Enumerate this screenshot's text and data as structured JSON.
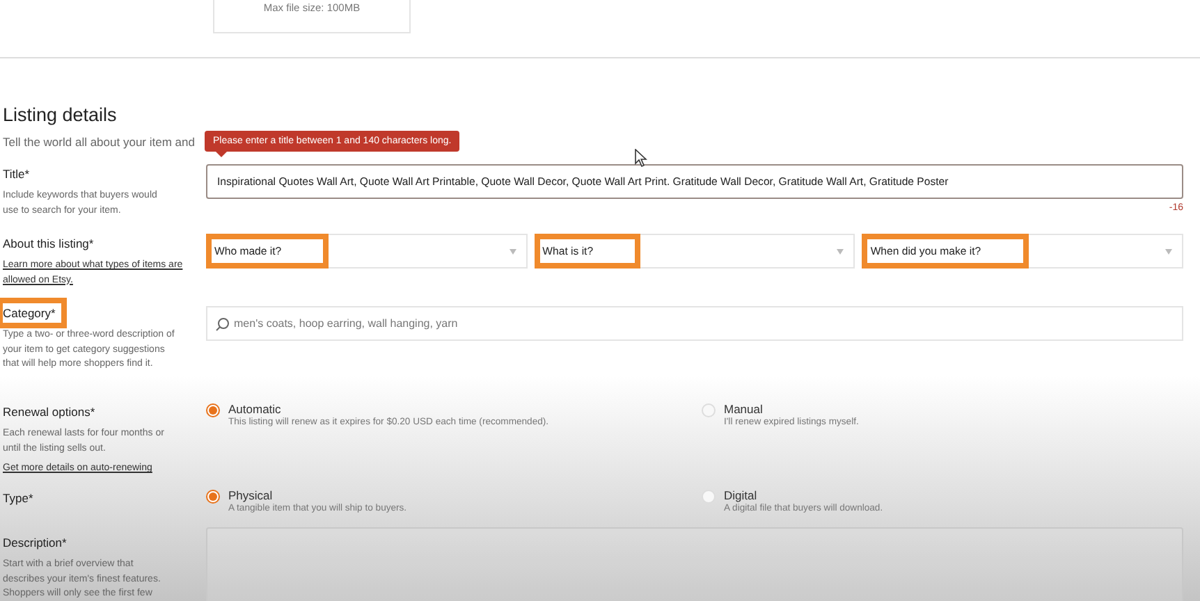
{
  "upload_box": {
    "note": "Max file size: 100MB"
  },
  "section": {
    "title": "Listing details",
    "subtitle": "Tell the world all about your item and"
  },
  "tooltip": {
    "text": "Please enter a title between 1 and 140 characters long."
  },
  "rows": [
    {
      "kind": "text",
      "label": "Title",
      "required": "*",
      "highlighted": false,
      "help": "Include keywords that buyers would use to search for your item.",
      "value": "Inspirational Quotes Wall Art, Quote Wall Art Printable, Quote Wall Decor, Quote Wall Art Print. Gratitude Wall Decor, Gratitude Wall Art, Gratitude Poster",
      "counter": "-16"
    },
    {
      "kind": "selects",
      "label": "About this listing",
      "required": "*",
      "highlighted": false,
      "link": "Learn more about what types of items are allowed on Etsy.",
      "selects": [
        {
          "placeholder": "Who made it?",
          "highlighted": true
        },
        {
          "placeholder": "What is it?",
          "highlighted": true
        },
        {
          "placeholder": "When did you make it?",
          "highlighted": true
        }
      ]
    },
    {
      "kind": "search",
      "label": "Category",
      "required": "*",
      "highlighted": true,
      "help": "Type a two- or three-word description of your item to get category suggestions that will help more shoppers find it.",
      "placeholder": "men's coats, hoop earring, wall hanging, yarn"
    },
    {
      "kind": "radios",
      "label": "Renewal options",
      "required": "*",
      "highlighted": false,
      "help": "Each renewal lasts for four months or until the listing sells out.",
      "link": "Get more details on auto-renewing",
      "options": [
        {
          "label": "Automatic",
          "description": "This listing will renew as it expires for $0.20 USD each time (recommended).",
          "selected": true
        },
        {
          "label": "Manual",
          "description": "I'll renew expired listings myself.",
          "selected": false
        }
      ]
    },
    {
      "kind": "radios",
      "label": "Type",
      "required": "*",
      "highlighted": false,
      "options": [
        {
          "label": "Physical",
          "description": "A tangible item that you will ship to buyers.",
          "selected": true
        },
        {
          "label": "Digital",
          "description": "A digital file that buyers will download.",
          "selected": false
        }
      ]
    },
    {
      "kind": "textarea",
      "label": "Description",
      "required": "*",
      "highlighted": false,
      "help": "Start with a brief overview that describes your item's finest features. Shoppers will only see the first few"
    }
  ]
}
